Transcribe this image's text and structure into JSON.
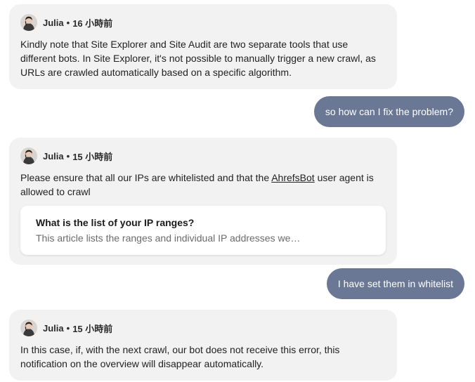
{
  "messages": {
    "m1": {
      "author": "Julia",
      "separator": "•",
      "time": "16 小時前",
      "body": "Kindly note that Site Explorer and Site Audit are two separate tools that use different bots. In Site Explorer, it's not possible to manually trigger a new crawl, as URLs are crawled automatically based on a specific algorithm."
    },
    "u1": {
      "text": "so how can I fix the problem?"
    },
    "m2": {
      "author": "Julia",
      "separator": "•",
      "time": "15 小時前",
      "body_before": "Please ensure that all our IPs are whitelisted and that the ",
      "link_text": "AhrefsBot",
      "body_after": " user agent is allowed to crawl",
      "article": {
        "title": "What is the list of your IP ranges?",
        "description": "This article lists the ranges and individual IP addresses we…"
      }
    },
    "u2": {
      "text": "I have set them in whitelist"
    },
    "m3": {
      "author": "Julia",
      "separator": "•",
      "time": "15 小時前",
      "body": "In this case, if, with the next crawl, our bot does not receive this error, this notification on the overview will disappear automatically."
    }
  },
  "colors": {
    "agent_bubble": "#f2f2f2",
    "user_bubble": "#6a7895"
  },
  "icons": {
    "avatar": "avatar-julia"
  }
}
